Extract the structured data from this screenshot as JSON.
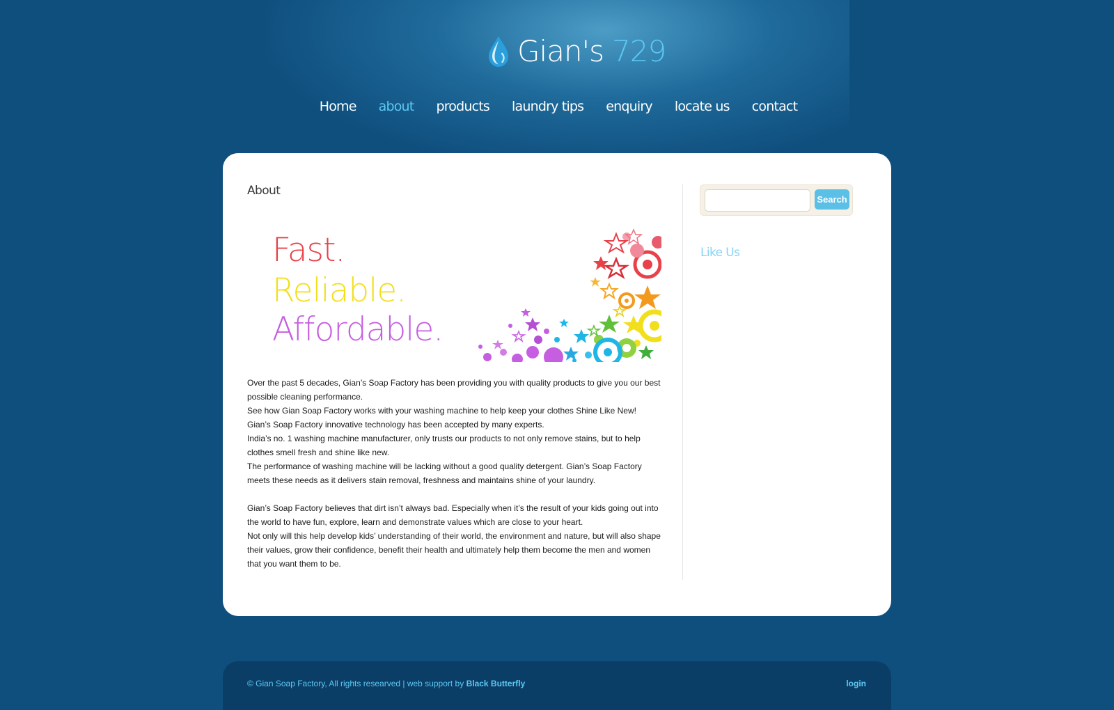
{
  "brand": {
    "name_part1": "Gian's",
    "name_part2": "729"
  },
  "nav": {
    "items": [
      {
        "label": "Home",
        "active": false
      },
      {
        "label": "about",
        "active": true
      },
      {
        "label": "products",
        "active": false
      },
      {
        "label": "laundry tips",
        "active": false
      },
      {
        "label": "enquiry",
        "active": false
      },
      {
        "label": "locate us",
        "active": false
      },
      {
        "label": "contact",
        "active": false
      }
    ]
  },
  "main": {
    "page_title": "About",
    "banner": {
      "line1": "Fast.",
      "line2": "Reliable.",
      "line3": "Affordable."
    },
    "paragraphs": [
      "Over the past 5 decades, Gian’s  Soap Factory has been providing you with quality products to give you our best possible cleaning performance.",
      "See how Gian Soap Factory works with your washing machine to help keep your clothes Shine Like New!",
      "Gian’s Soap Factory innovative technology has been accepted by many experts.",
      "India’s no. 1 washing machine manufacturer, only trusts our products to not only remove stains, but to help clothes smell fresh and shine like new.",
      "The performance of washing machine will be lacking without a good quality detergent. Gian’s Soap Factory meets these needs as it delivers stain removal, freshness and maintains shine of your laundry.",
      "Gian’s Soap Factory believes that dirt isn’t always bad. Especially when it’s the result of your kids going out into the world to have fun, explore, learn and demonstrate values which are close to your heart.",
      "Not only will this help develop kids’ understanding of their world, the environment and nature, but will also shape their values, grow their confidence, benefit their health and ultimately help them become the men and women that you want them to be."
    ]
  },
  "sidebar": {
    "search": {
      "placeholder": "",
      "button_label": "Search"
    },
    "like_us_heading": "Like Us"
  },
  "footer": {
    "copyright": "© Gian Soap Factory, All rights researved | web support by ",
    "support_link": "Black Butterfly",
    "login_label": "login"
  },
  "colors": {
    "background": "#0f4f7e",
    "accent": "#5cc8f2",
    "panel": "#ffffff",
    "footer": "#0b3e67"
  },
  "icons": {
    "logo": "water-drop-icon"
  }
}
